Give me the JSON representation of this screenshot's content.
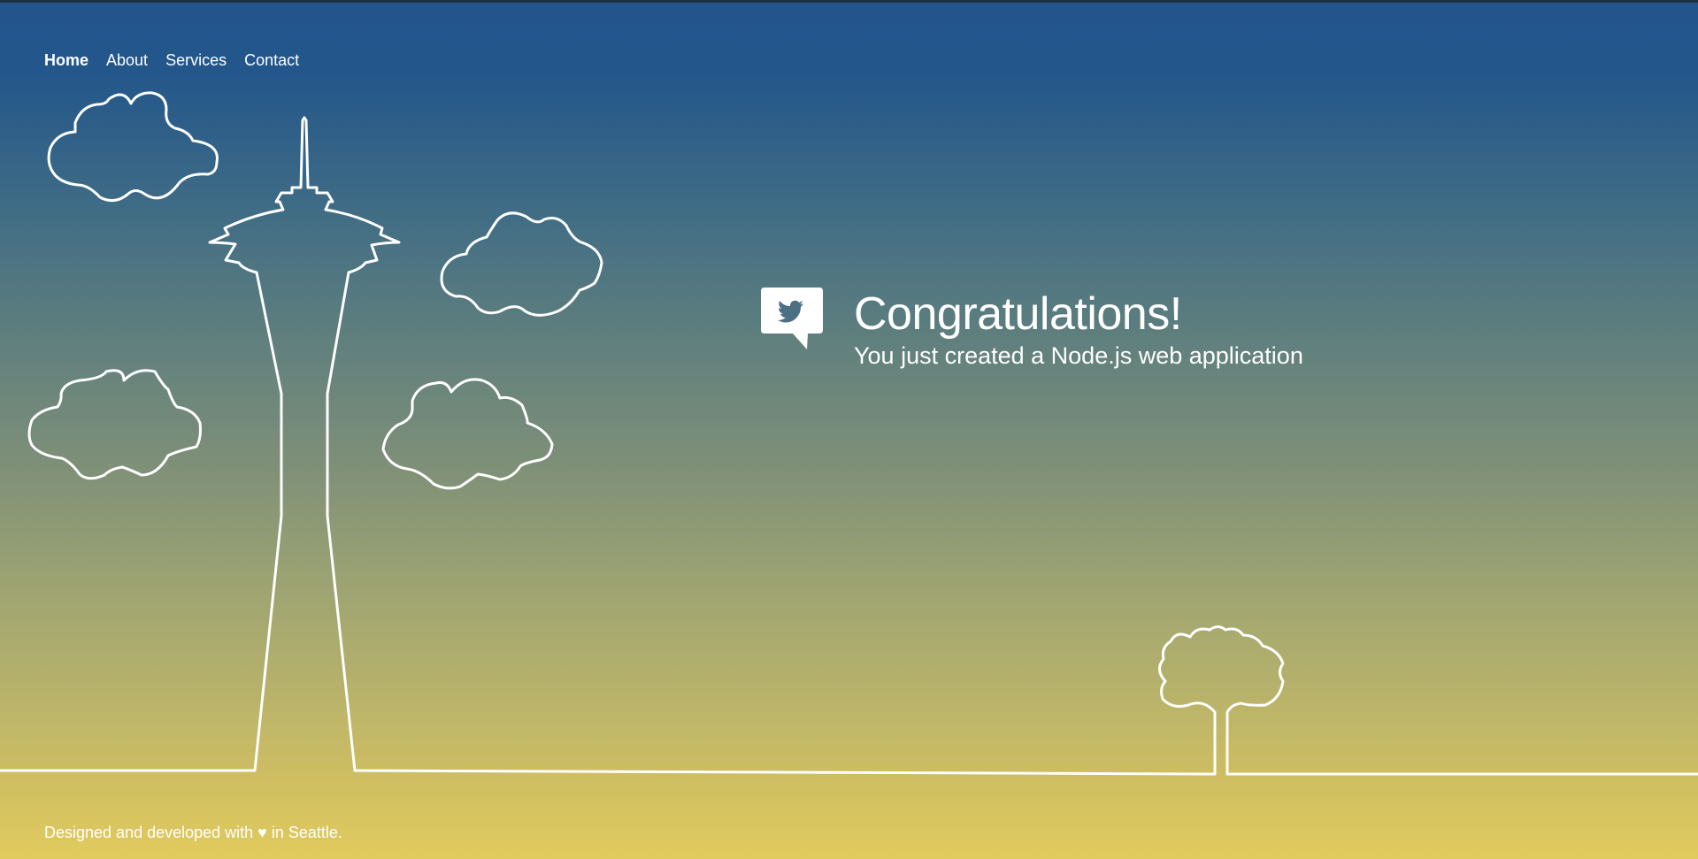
{
  "nav": {
    "items": [
      {
        "label": "Home",
        "active": true
      },
      {
        "label": "About",
        "active": false
      },
      {
        "label": "Services",
        "active": false
      },
      {
        "label": "Contact",
        "active": false
      }
    ]
  },
  "hero": {
    "icon": "twitter-bird-speech-bubble-icon",
    "title": "Congratulations!",
    "subtitle": "You just created a Node.js web application"
  },
  "footer": {
    "text": "Designed and developed with ♥ in Seattle."
  },
  "colors": {
    "gradient_top": "#23558c",
    "gradient_bottom": "#e2cb5e",
    "line": "#ffffff"
  }
}
